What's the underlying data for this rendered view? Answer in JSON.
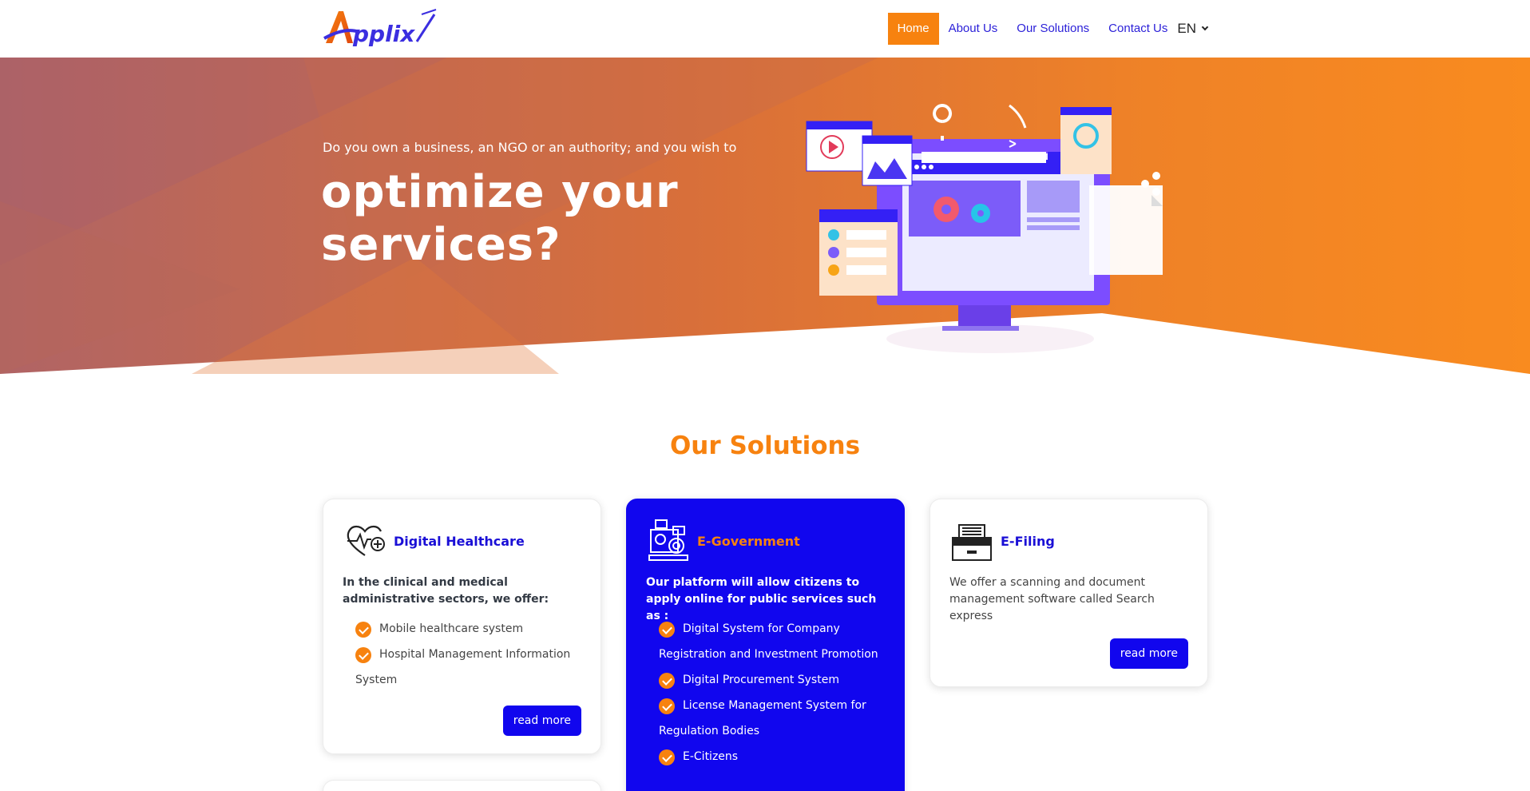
{
  "brand": {
    "logo_text": "Applix",
    "accent": "#f7820f",
    "primary": "#1106ee"
  },
  "nav": {
    "items": [
      {
        "label": "Home",
        "active": true
      },
      {
        "label": "About Us",
        "active": false
      },
      {
        "label": "Our Solutions",
        "active": false
      },
      {
        "label": "Contact Us",
        "active": false
      }
    ],
    "language": "EN"
  },
  "hero": {
    "intro": "Do you own a business, an NGO or an authority; and you wish to",
    "title": "optimize your services?"
  },
  "solutions": {
    "heading": "Our Solutions",
    "cards": [
      {
        "title": "Digital Healthcare",
        "icon": "heart-pulse-icon",
        "lead": "In the clinical and medical administrative sectors, we offer:",
        "items": [
          "Mobile healthcare system",
          "Hospital Management Information System"
        ],
        "button": "read more"
      },
      {
        "title": "E-Government",
        "icon": "government-services-icon",
        "lead": "Our platform will allow citizens to apply online for public services such as :",
        "items": [
          "Digital System for Company Registration and Investment Promotion",
          "Digital Procurement System",
          "License Management System for Regulation Bodies",
          "E-Citizens"
        ]
      },
      {
        "title": "E-Filing",
        "icon": "file-cabinet-icon",
        "text": "We offer a scanning and document management software called Search express",
        "button": "read more"
      }
    ]
  }
}
